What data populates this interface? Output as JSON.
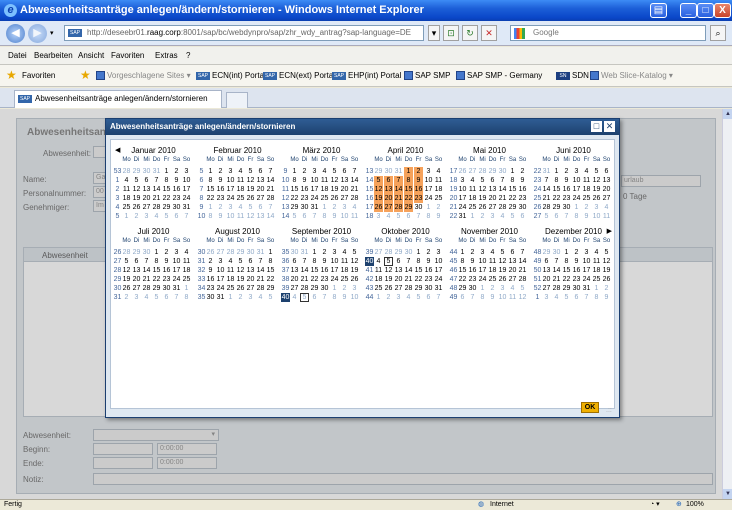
{
  "window": {
    "title": "Abwesenheitsanträge anlegen/ändern/stornieren - Windows Internet Explorer",
    "app_icon": "e",
    "min": "_",
    "max": "□",
    "close": "X"
  },
  "address": {
    "url_pre": "http://deseebr01.",
    "url_host": "raag.corp",
    "url_post": ":8001/sap/bc/webdynpro/sap/zhr_wdy_antrag?sap-language=DE",
    "search_placeholder": "Google"
  },
  "menu": [
    "Datei",
    "Bearbeiten",
    "Ansicht",
    "Favoriten",
    "Extras",
    "?"
  ],
  "favorites": {
    "label": "Favoriten",
    "items": [
      "Vorgeschlagene Sites ▾",
      "ECN(int) Portal",
      "ECN(ext) Portal",
      "EHP(int) Portal",
      "SAP SMP",
      "SAP SMP - Germany",
      "SDN",
      "Web Slice-Katalog ▾"
    ]
  },
  "tab": {
    "title": "Abwesenheitsanträge anlegen/ändern/stornieren"
  },
  "form": {
    "panel_title": "Abwesenheitsantra",
    "abwesenheit_label": "Abwesenheit:",
    "name_label": "Name:",
    "name_value": "Ga",
    "personal_label": "Personalnummer:",
    "personal_value": "00",
    "genehmiger_label": "Genehmiger:",
    "genehmiger_value": "Im",
    "right1": "urlaub",
    "right2": "0 Tage",
    "grid_header": "Abwesenheit",
    "abw2_label": "Abwesenheit:",
    "beginn_label": "Beginn:",
    "ende_label": "Ende:",
    "notiz_label": "Notiz:",
    "time1": "0:00:00",
    "time2": "0:00:00"
  },
  "dialog": {
    "title": "Abwesenheitsanträge anlegen/ändern/stornieren",
    "ok_label": "OK",
    "day_names": [
      "Mo",
      "Di",
      "Mi",
      "Do",
      "Fr",
      "Sa",
      "So"
    ],
    "months": [
      {
        "name": "Januar 2010",
        "nav": "prev",
        "weeks": [
          [
            "53",
            "28",
            "29",
            "30",
            "31",
            "1",
            "2",
            "3"
          ],
          [
            "1",
            "4",
            "5",
            "6",
            "7",
            "8",
            "9",
            "10"
          ],
          [
            "2",
            "11",
            "12",
            "13",
            "14",
            "15",
            "16",
            "17"
          ],
          [
            "3",
            "18",
            "19",
            "20",
            "21",
            "22",
            "23",
            "24"
          ],
          [
            "4",
            "25",
            "26",
            "27",
            "28",
            "29",
            "30",
            "31"
          ],
          [
            "5",
            "1",
            "2",
            "3",
            "4",
            "5",
            "6",
            "7"
          ]
        ],
        "first_row_lead": 4,
        "last_row_in": 0
      },
      {
        "name": "Februar 2010",
        "weeks": [
          [
            "5",
            "1",
            "2",
            "3",
            "4",
            "5",
            "6",
            "7"
          ],
          [
            "6",
            "8",
            "9",
            "10",
            "11",
            "12",
            "13",
            "14"
          ],
          [
            "7",
            "15",
            "16",
            "17",
            "18",
            "19",
            "20",
            "21"
          ],
          [
            "8",
            "22",
            "23",
            "24",
            "25",
            "26",
            "27",
            "28"
          ],
          [
            "9",
            "1",
            "2",
            "3",
            "4",
            "5",
            "6",
            "7"
          ],
          [
            "10",
            "8",
            "9",
            "10",
            "11",
            "12",
            "13",
            "14"
          ]
        ],
        "first_row_lead": 0,
        "tail_rows": 2
      },
      {
        "name": "März 2010",
        "weeks": [
          [
            "9",
            "1",
            "2",
            "3",
            "4",
            "5",
            "6",
            "7"
          ],
          [
            "10",
            "8",
            "9",
            "10",
            "11",
            "12",
            "13",
            "14"
          ],
          [
            "11",
            "15",
            "16",
            "17",
            "18",
            "19",
            "20",
            "21"
          ],
          [
            "12",
            "22",
            "23",
            "24",
            "25",
            "26",
            "27",
            "28"
          ],
          [
            "13",
            "29",
            "30",
            "31",
            "1",
            "2",
            "3",
            "4"
          ],
          [
            "14",
            "5",
            "6",
            "7",
            "8",
            "9",
            "10",
            "11"
          ]
        ],
        "first_row_lead": 0,
        "last_row_in": 3
      },
      {
        "name": "April 2010",
        "weeks": [
          [
            "13",
            "29",
            "30",
            "31",
            "1",
            "2",
            "3",
            "4"
          ],
          [
            "14",
            "5",
            "6",
            "7",
            "8",
            "9",
            "10",
            "11"
          ],
          [
            "15",
            "12",
            "13",
            "14",
            "15",
            "16",
            "17",
            "18"
          ],
          [
            "16",
            "19",
            "20",
            "21",
            "22",
            "23",
            "24",
            "25"
          ],
          [
            "17",
            "26",
            "27",
            "28",
            "29",
            "30",
            "1",
            "2"
          ],
          [
            "18",
            "3",
            "4",
            "5",
            "6",
            "7",
            "8",
            "9"
          ]
        ],
        "first_row_lead": 3,
        "last_row_in": 5
      },
      {
        "name": "Mai 2010",
        "weeks": [
          [
            "17",
            "26",
            "27",
            "28",
            "29",
            "30",
            "1",
            "2"
          ],
          [
            "18",
            "3",
            "4",
            "5",
            "6",
            "7",
            "8",
            "9"
          ],
          [
            "19",
            "10",
            "11",
            "12",
            "13",
            "14",
            "15",
            "16"
          ],
          [
            "20",
            "17",
            "18",
            "19",
            "20",
            "21",
            "22",
            "23"
          ],
          [
            "21",
            "24",
            "25",
            "26",
            "27",
            "28",
            "29",
            "30"
          ],
          [
            "22",
            "31",
            "1",
            "2",
            "3",
            "4",
            "5",
            "6"
          ]
        ],
        "first_row_lead": 5,
        "last_row_in": 1
      },
      {
        "name": "Juni 2010",
        "weeks": [
          [
            "22",
            "31",
            "1",
            "2",
            "3",
            "4",
            "5",
            "6"
          ],
          [
            "23",
            "7",
            "8",
            "9",
            "10",
            "11",
            "12",
            "13"
          ],
          [
            "24",
            "14",
            "15",
            "16",
            "17",
            "18",
            "19",
            "20"
          ],
          [
            "25",
            "21",
            "22",
            "23",
            "24",
            "25",
            "26",
            "27"
          ],
          [
            "26",
            "28",
            "29",
            "30",
            "1",
            "2",
            "3",
            "4"
          ],
          [
            "27",
            "5",
            "6",
            "7",
            "8",
            "9",
            "10",
            "11"
          ]
        ],
        "first_row_lead": 1,
        "last_row_in": 3
      },
      {
        "name": "Juli 2010",
        "weeks": [
          [
            "26",
            "28",
            "29",
            "30",
            "1",
            "2",
            "3",
            "4"
          ],
          [
            "27",
            "5",
            "6",
            "7",
            "8",
            "9",
            "10",
            "11"
          ],
          [
            "28",
            "12",
            "13",
            "14",
            "15",
            "16",
            "17",
            "18"
          ],
          [
            "29",
            "19",
            "20",
            "21",
            "22",
            "23",
            "24",
            "25"
          ],
          [
            "30",
            "26",
            "27",
            "28",
            "29",
            "30",
            "31",
            "1"
          ],
          [
            "31",
            "2",
            "3",
            "4",
            "5",
            "6",
            "7",
            "8"
          ]
        ],
        "first_row_lead": 3,
        "last_row_in": 6
      },
      {
        "name": "August 2010",
        "weeks": [
          [
            "30",
            "26",
            "27",
            "28",
            "29",
            "30",
            "31",
            "1"
          ],
          [
            "31",
            "2",
            "3",
            "4",
            "5",
            "6",
            "7",
            "8"
          ],
          [
            "32",
            "9",
            "10",
            "11",
            "12",
            "13",
            "14",
            "15"
          ],
          [
            "33",
            "16",
            "17",
            "18",
            "19",
            "20",
            "21",
            "22"
          ],
          [
            "34",
            "23",
            "24",
            "25",
            "26",
            "27",
            "28",
            "29"
          ],
          [
            "35",
            "30",
            "31",
            "1",
            "2",
            "3",
            "4",
            "5"
          ]
        ],
        "first_row_lead": 6,
        "last_row_in": 2
      },
      {
        "name": "September 2010",
        "weeks": [
          [
            "35",
            "30",
            "31",
            "1",
            "2",
            "3",
            "4",
            "5"
          ],
          [
            "36",
            "6",
            "7",
            "8",
            "9",
            "10",
            "11",
            "12"
          ],
          [
            "37",
            "13",
            "14",
            "15",
            "16",
            "17",
            "18",
            "19"
          ],
          [
            "38",
            "20",
            "21",
            "22",
            "23",
            "24",
            "25",
            "26"
          ],
          [
            "39",
            "27",
            "28",
            "29",
            "30",
            "1",
            "2",
            "3"
          ],
          [
            "40",
            "4",
            "5",
            "6",
            "7",
            "8",
            "9",
            "10"
          ]
        ],
        "first_row_lead": 2,
        "last_row_in": 4
      },
      {
        "name": "Oktober 2010",
        "weeks": [
          [
            "39",
            "27",
            "28",
            "29",
            "30",
            "1",
            "2",
            "3"
          ],
          [
            "40",
            "4",
            "5",
            "6",
            "7",
            "8",
            "9",
            "10"
          ],
          [
            "41",
            "11",
            "12",
            "13",
            "14",
            "15",
            "16",
            "17"
          ],
          [
            "42",
            "18",
            "19",
            "20",
            "21",
            "22",
            "23",
            "24"
          ],
          [
            "43",
            "25",
            "26",
            "27",
            "28",
            "29",
            "30",
            "31"
          ],
          [
            "44",
            "1",
            "2",
            "3",
            "4",
            "5",
            "6",
            "7"
          ]
        ],
        "first_row_lead": 4,
        "last_row_in": 7
      },
      {
        "name": "November 2010",
        "weeks": [
          [
            "44",
            "1",
            "2",
            "3",
            "4",
            "5",
            "6",
            "7"
          ],
          [
            "45",
            "8",
            "9",
            "10",
            "11",
            "12",
            "13",
            "14"
          ],
          [
            "46",
            "15",
            "16",
            "17",
            "18",
            "19",
            "20",
            "21"
          ],
          [
            "47",
            "22",
            "23",
            "24",
            "25",
            "26",
            "27",
            "28"
          ],
          [
            "48",
            "29",
            "30",
            "1",
            "2",
            "3",
            "4",
            "5"
          ],
          [
            "49",
            "6",
            "7",
            "8",
            "9",
            "10",
            "11",
            "12"
          ]
        ],
        "first_row_lead": 0,
        "last_row_in": 2
      },
      {
        "name": "Dezember 2010",
        "nav": "next",
        "weeks": [
          [
            "48",
            "29",
            "30",
            "1",
            "2",
            "3",
            "4",
            "5"
          ],
          [
            "49",
            "6",
            "7",
            "8",
            "9",
            "10",
            "11",
            "12"
          ],
          [
            "50",
            "13",
            "14",
            "15",
            "16",
            "17",
            "18",
            "19"
          ],
          [
            "51",
            "20",
            "21",
            "22",
            "23",
            "24",
            "25",
            "26"
          ],
          [
            "52",
            "27",
            "28",
            "29",
            "30",
            "31",
            "1",
            "2"
          ],
          [
            "1",
            "3",
            "4",
            "5",
            "6",
            "7",
            "8",
            "9"
          ]
        ],
        "first_row_lead": 2,
        "last_row_in": 5
      }
    ]
  },
  "status": {
    "left": "Fertig",
    "zone": "Internet",
    "zoom": "100%"
  }
}
